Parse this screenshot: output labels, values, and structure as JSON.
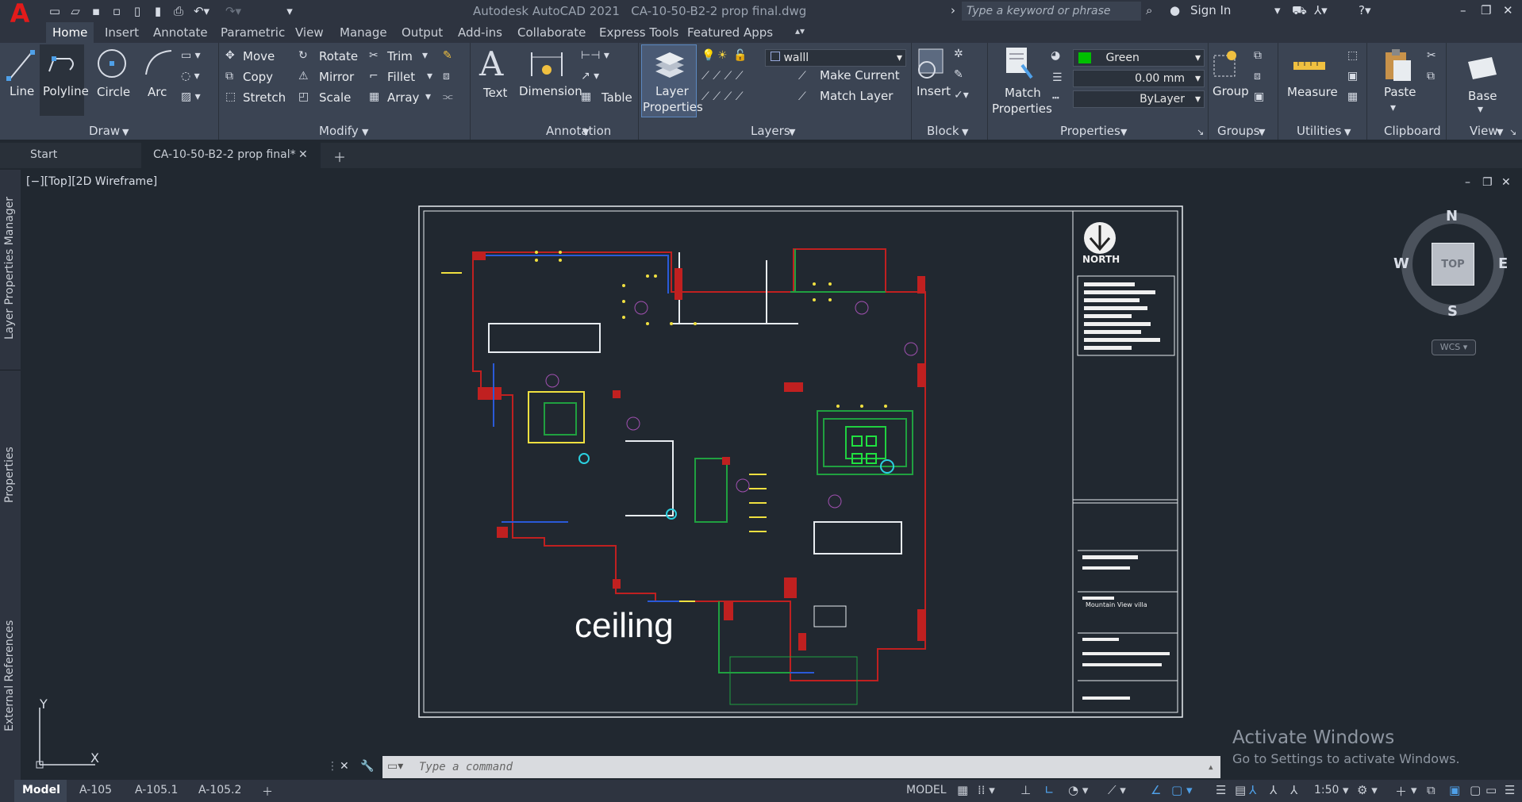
{
  "app": {
    "title": "Autodesk AutoCAD 2021",
    "filename": "CA-10-50-B2-2 prop final.dwg",
    "logo": "A",
    "search_placeholder": "Type a keyword or phrase",
    "sign_in": "Sign In"
  },
  "ribbon_tabs": [
    "Home",
    "Insert",
    "Annotate",
    "Parametric",
    "View",
    "Manage",
    "Output",
    "Add-ins",
    "Collaborate",
    "Express Tools",
    "Featured Apps"
  ],
  "draw": {
    "line": "Line",
    "polyline": "Polyline",
    "circle": "Circle",
    "arc": "Arc",
    "title": "Draw"
  },
  "modify": {
    "move": "Move",
    "rotate": "Rotate",
    "trim": "Trim",
    "copy": "Copy",
    "mirror": "Mirror",
    "fillet": "Fillet",
    "stretch": "Stretch",
    "scale": "Scale",
    "array": "Array",
    "title": "Modify"
  },
  "annotation": {
    "text": "Text",
    "dimension": "Dimension",
    "table": "Table",
    "title": "Annotation"
  },
  "layers": {
    "layer_properties_1": "Layer",
    "layer_properties_2": "Properties",
    "current_layer": "walll",
    "make_current": "Make Current",
    "match_layer": "Match Layer",
    "title": "Layers"
  },
  "block": {
    "insert": "Insert",
    "title": "Block"
  },
  "properties": {
    "match_1": "Match",
    "match_2": "Properties",
    "color": "Green",
    "lineweight": "0.00 mm",
    "linetype": "ByLayer",
    "title": "Properties"
  },
  "groups": {
    "group": "Group",
    "title": "Groups"
  },
  "utilities": {
    "measure": "Measure",
    "title": "Utilities"
  },
  "clipboard": {
    "paste": "Paste",
    "title": "Clipboard"
  },
  "view_panel": {
    "base": "Base",
    "title": "View"
  },
  "doc_tabs": {
    "start": "Start",
    "active": "CA-10-50-B2-2 prop final*"
  },
  "viewport": {
    "controls": "[−][Top][2D Wireframe]"
  },
  "side_palettes": [
    "Layer Properties Manager",
    "Properties",
    "External References"
  ],
  "drawing": {
    "label": "ceiling",
    "north": "NORTH",
    "project": "Mountain View villa"
  },
  "viewcube": {
    "n": "N",
    "s": "S",
    "e": "E",
    "w": "W",
    "top": "TOP",
    "wcs": "WCS"
  },
  "ucs": {
    "x": "X",
    "y": "Y"
  },
  "command": {
    "placeholder": "Type a command"
  },
  "layout_tabs": [
    "Model",
    "A-105",
    "A-105.1",
    "A-105.2"
  ],
  "status": {
    "model": "MODEL",
    "scale": "1:50"
  },
  "watermark": {
    "line1": "Activate Windows",
    "line2": "Go to Settings to activate Windows."
  },
  "colors": {
    "bg": "#212830",
    "ribbon": "#3b4453",
    "accent": "#e21b1b",
    "green": "#00c000"
  }
}
